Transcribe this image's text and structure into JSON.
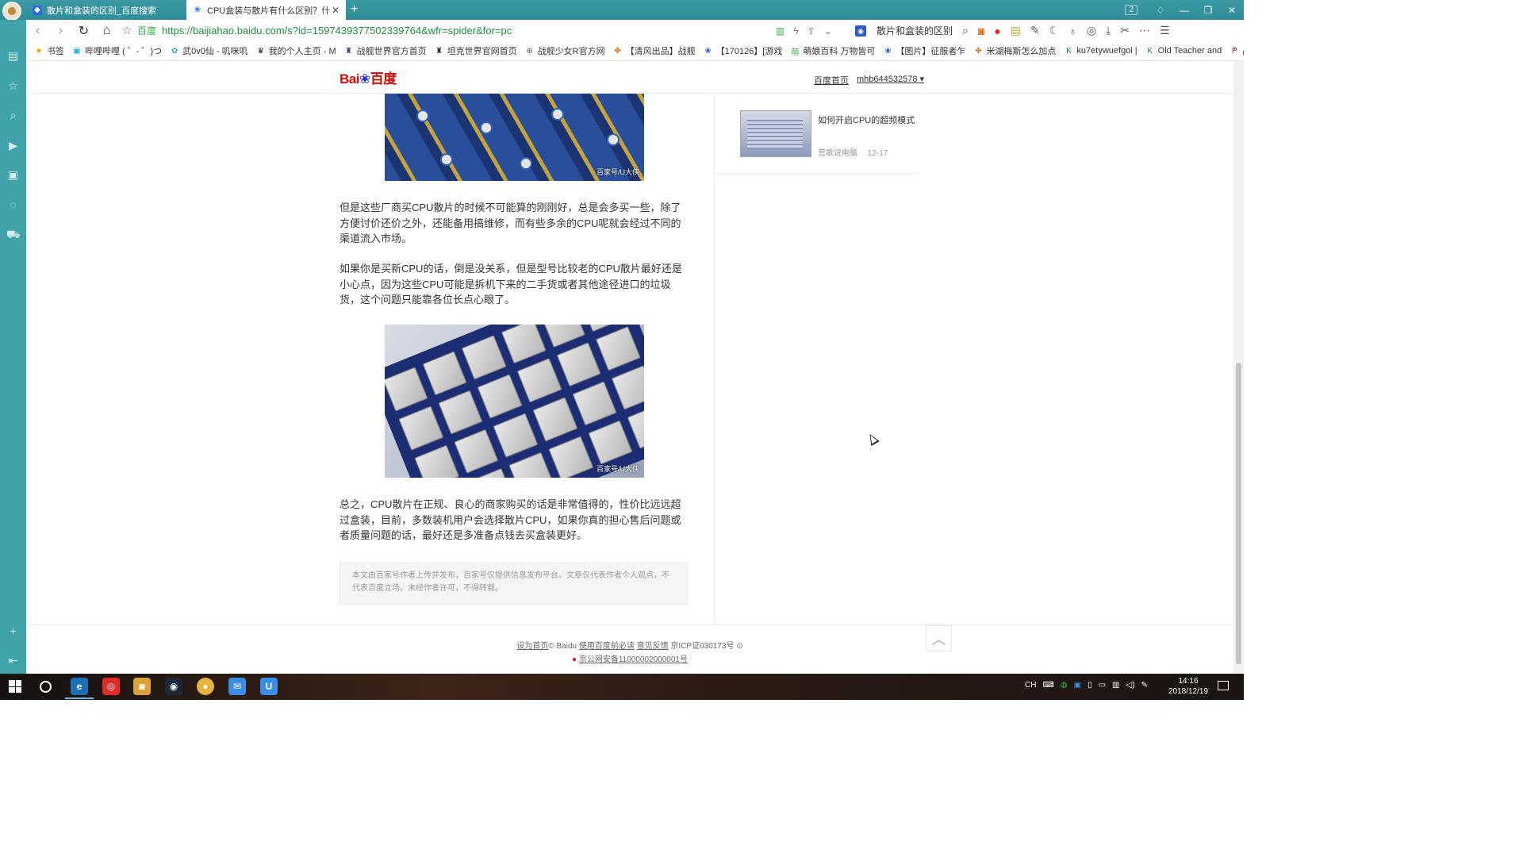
{
  "tabs": [
    {
      "title": "散片和盒装的区别_百度搜索",
      "active": false
    },
    {
      "title": "CPU盒装与散片有什么区别？什么是",
      "active": true
    }
  ],
  "window": {
    "tab_count": "2"
  },
  "address": {
    "site_label": "百度",
    "url": "https://baijiahao.baidu.com/s?id=1597439377502339764&wfr=spider&for=pc",
    "search_text": "散片和盒装的区别"
  },
  "bookmarks": [
    {
      "label": "书签",
      "icon": "star-icon",
      "color": "#f2a100"
    },
    {
      "label": "哔哩哔哩 ( ゜- ゜)つ",
      "icon": "tv-icon",
      "color": "#23ade5"
    },
    {
      "label": "武0v0仙 - 叽咪叽",
      "icon": "game-icon",
      "color": "#37a3c8"
    },
    {
      "label": "我的个人主页 - M",
      "icon": "shield-icon",
      "color": "#222222"
    },
    {
      "label": "战舰世界官方首页",
      "icon": "wows-icon",
      "color": "#2b3f6b"
    },
    {
      "label": "坦克世界官网首页",
      "icon": "wot-icon",
      "color": "#222222"
    },
    {
      "label": "战舰少女R官方网",
      "icon": "globe-icon",
      "color": "#555555"
    },
    {
      "label": "【清风出品】战舰",
      "icon": "leaf-icon",
      "color": "#e46a1a"
    },
    {
      "label": "【170126】[游戏",
      "icon": "paw-icon",
      "color": "#2d59c9"
    },
    {
      "label": "萌娘百科 万物皆可",
      "icon": "moe-icon",
      "color": "#3ab549"
    },
    {
      "label": "【图片】征服者乍",
      "icon": "paw-icon",
      "color": "#2d59c9"
    },
    {
      "label": "米湖梅斯怎么加点",
      "icon": "leaf-icon",
      "color": "#e46a1a"
    },
    {
      "label": "ku7etywuefgoi |",
      "icon": "k-icon",
      "color": "#1b7b3c"
    },
    {
      "label": "Old Teacher and",
      "icon": "k-icon",
      "color": "#1b7b3c"
    },
    {
      "label": "战舰",
      "icon": "p-icon",
      "color": "#c83b2b"
    }
  ],
  "header": {
    "home_link": "百度首页",
    "username": "mhb644532578"
  },
  "article": {
    "image1_watermark": "百家号/U大侠",
    "paragraph1": "但是这些厂商买CPU散片的时候不可能算的刚刚好，总是会多买一些，除了方便讨价还价之外，还能备用搞维修，而有些多余的CPU呢就会经过不同的渠道流入市场。",
    "paragraph2": "如果你是买新CPU的话，倒是没关系，但是型号比较老的CPU散片最好还是小心点，因为这些CPU可能是拆机下来的二手货或者其他途径进口的垃圾货，这个问题只能靠各位长点心眼了。",
    "image2_watermark": "百家号/U大侠",
    "paragraph3": "总之，CPU散片在正规、良心的商家购买的话是非常值得的，性价比远远超过盒装，目前，多数装机用户会选择散片CPU，如果你真的担心售后问题或者质量问题的话，最好还是多准备点钱去买盒装更好。",
    "disclaimer": "本文由百家号作者上传并发布，百家号仅提供信息发布平台。文章仅代表作者个人观点，不代表百度立场。未经作者许可，不得转载。"
  },
  "related": {
    "title": "如何开启CPU的超频模式",
    "author": "营歌说电脑",
    "date": "12-17"
  },
  "footer": {
    "set_home": "设为首页",
    "copyright": "© Baidu",
    "must_read": "使用百度前必读",
    "feedback": "意见反馈",
    "icp": "京ICP证030173号",
    "police": "京公网安备11000002000001号"
  },
  "taskbar": {
    "ime": "CH",
    "time": "14:16",
    "date": "2018/12/19"
  }
}
